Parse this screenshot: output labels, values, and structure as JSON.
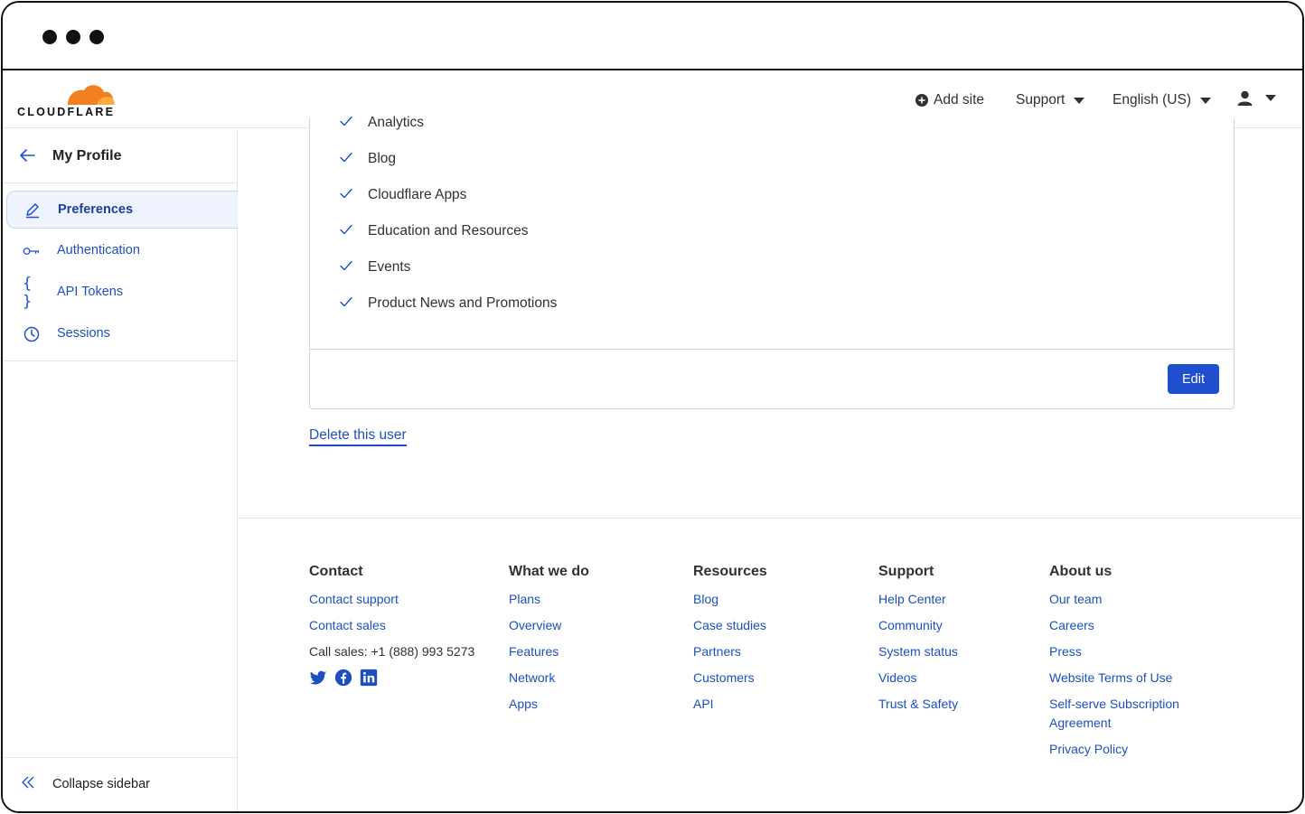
{
  "brand": {
    "name": "CLOUDFLARE",
    "accent": "#f38020",
    "link_color": "#1d4fc2"
  },
  "header": {
    "add_site": "Add site",
    "support": "Support",
    "language": "English (US)"
  },
  "sidebar": {
    "back_title": "My Profile",
    "items": [
      {
        "label": "Preferences",
        "icon": "pencil-icon"
      },
      {
        "label": "Authentication",
        "icon": "key-icon"
      },
      {
        "label": "API Tokens",
        "icon": "braces-icon"
      },
      {
        "label": "Sessions",
        "icon": "clock-icon"
      }
    ],
    "active": "Preferences",
    "collapse_label": "Collapse sidebar"
  },
  "main": {
    "checked_items": [
      "Analytics",
      "Blog",
      "Cloudflare Apps",
      "Education and Resources",
      "Events",
      "Product News and Promotions"
    ],
    "edit_label": "Edit",
    "delete_label": "Delete this user"
  },
  "footer": {
    "contact": {
      "title": "Contact",
      "links": [
        "Contact support",
        "Contact sales"
      ],
      "call_sales": "Call sales: +1 (888) 993 5273",
      "socials": [
        "twitter-icon",
        "facebook-icon",
        "linkedin-icon"
      ]
    },
    "what_we_do": {
      "title": "What we do",
      "links": [
        "Plans",
        "Overview",
        "Features",
        "Network",
        "Apps"
      ]
    },
    "resources": {
      "title": "Resources",
      "links": [
        "Blog",
        "Case studies",
        "Partners",
        "Customers",
        "API"
      ]
    },
    "support": {
      "title": "Support",
      "links": [
        "Help Center",
        "Community",
        "System status",
        "Videos",
        "Trust & Safety"
      ]
    },
    "about_us": {
      "title": "About us",
      "links": [
        "Our team",
        "Careers",
        "Press",
        "Website Terms of Use",
        "Self-serve Subscription Agreement",
        "Privacy Policy"
      ]
    }
  }
}
